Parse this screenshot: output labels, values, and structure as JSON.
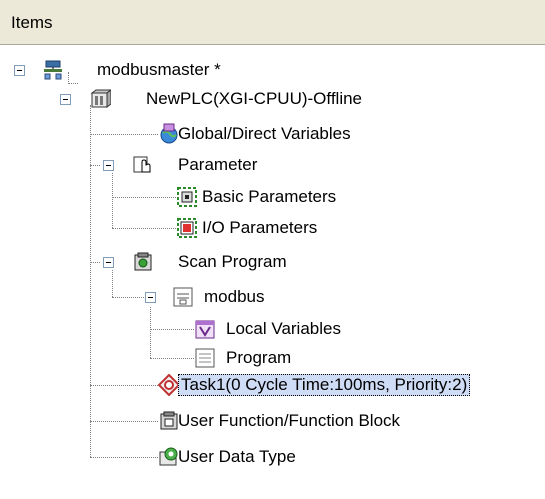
{
  "panel": {
    "header": "Items"
  },
  "tree": {
    "root": "modbusmaster *",
    "plc": "NewPLC(XGI-CPUU)-Offline",
    "global_vars": "Global/Direct Variables",
    "parameter": "Parameter",
    "basic_params": "Basic Parameters",
    "io_params": "I/O Parameters",
    "scan_program": "Scan Program",
    "modbus": "modbus",
    "local_vars": "Local Variables",
    "program": "Program",
    "task": "Task1(0 Cycle Time:100ms, Priority:2)",
    "user_function": "User Function/Function Block",
    "user_data_type": "User Data Type"
  }
}
